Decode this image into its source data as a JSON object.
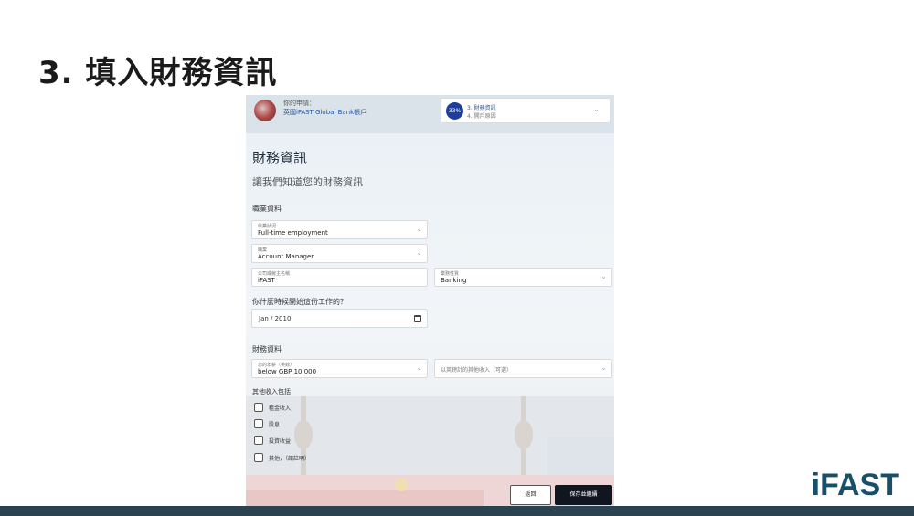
{
  "slide": {
    "title": "3. 填入財務資訊",
    "logo_text": "iFAST"
  },
  "app": {
    "header": {
      "label": "你的申請：",
      "name": "英國iFAST Global Bank帳戶",
      "progress": {
        "percent_label": "33%",
        "current_step": "3. 財務資訊",
        "next_step": "4. 開戶原因"
      }
    },
    "form": {
      "title": "財務資訊",
      "subtitle": "讓我們知道您的財務資訊",
      "employment_section": "職業資料",
      "employment_status": {
        "label": "就業狀況",
        "value": "Full-time employment"
      },
      "occupation": {
        "label": "職業",
        "value": "Account Manager"
      },
      "employer": {
        "label": "公司或僱主名稱",
        "value": "iFAST"
      },
      "industry": {
        "label": "業務性質",
        "value": "Banking"
      },
      "start_question": "你什麼時候開始這份工作的？",
      "start_date": "Jan / 2010",
      "financial_section": "財務資料",
      "annual_income": {
        "label": "您的年薪（英鎊）",
        "value": "below GBP 10,000"
      },
      "other_income_placeholder": "以英鎊計的其他收入（可選）",
      "other_income_label": "其他收入包括",
      "checkboxes": [
        {
          "label": "租金收入"
        },
        {
          "label": "股息"
        },
        {
          "label": "投資收益"
        },
        {
          "label": "其他，（請註明）"
        }
      ],
      "back_button": "返回",
      "save_button": "保存並繼續"
    }
  }
}
